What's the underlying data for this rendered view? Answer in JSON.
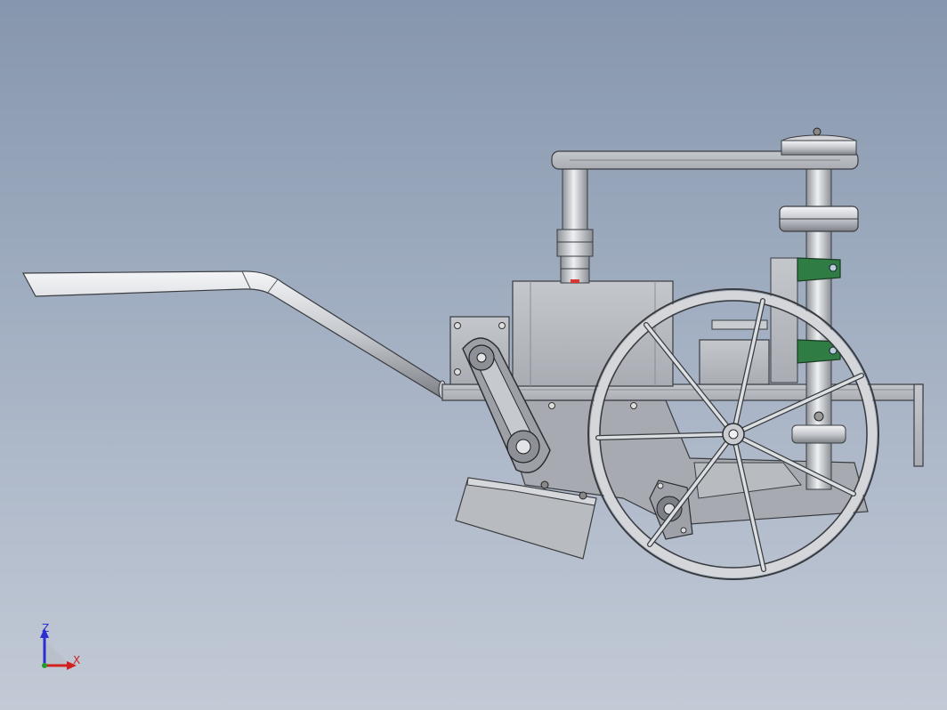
{
  "viewport": {
    "background_top": "#8696ad",
    "background_bottom": "#c3cad6"
  },
  "model": {
    "metal_color": "#b9bcc2",
    "edge_color": "#3a3c40",
    "accent_color": "#2f7d44",
    "marker_color": "#d8362e"
  },
  "triad": {
    "z_label": "Z",
    "x_label": "X",
    "z_color": "#2a2fd0",
    "x_color": "#d02020",
    "y_color": "#1f9e2f"
  }
}
